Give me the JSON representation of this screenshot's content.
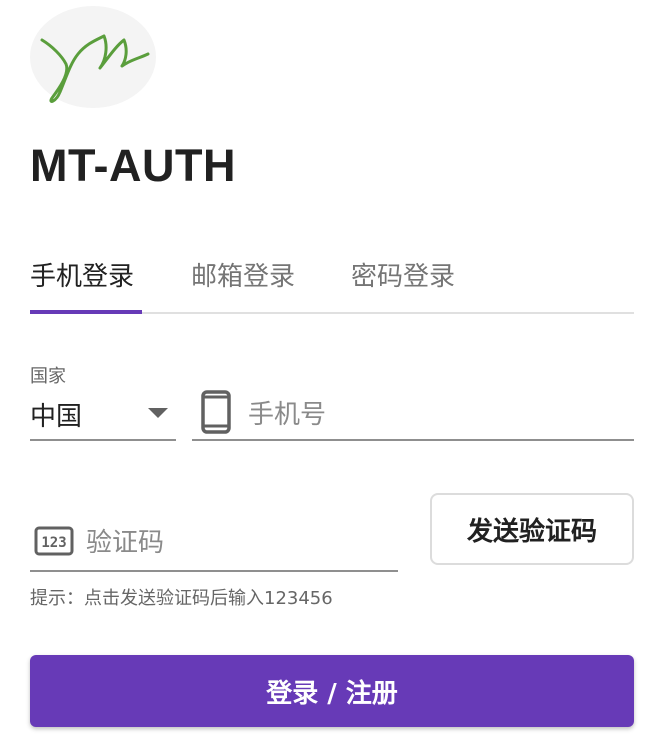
{
  "app": {
    "title": "MT-AUTH",
    "accent_color": "#673ab7"
  },
  "logo": {
    "icon": "signature-logo-icon"
  },
  "tabs": [
    {
      "label": "手机登录",
      "active": true
    },
    {
      "label": "邮箱登录",
      "active": false
    },
    {
      "label": "密码登录",
      "active": false
    }
  ],
  "form": {
    "country": {
      "label": "国家",
      "value": "中国"
    },
    "phone": {
      "placeholder": "手机号",
      "value": "",
      "icon": "phone-icon"
    },
    "code": {
      "placeholder": "验证码",
      "value": "",
      "icon": "numeric-123-icon",
      "icon_text": "123"
    },
    "send_code_label": "发送验证码",
    "hint": "提示：点击发送验证码后输入123456",
    "submit_label": "登录 / 注册"
  }
}
